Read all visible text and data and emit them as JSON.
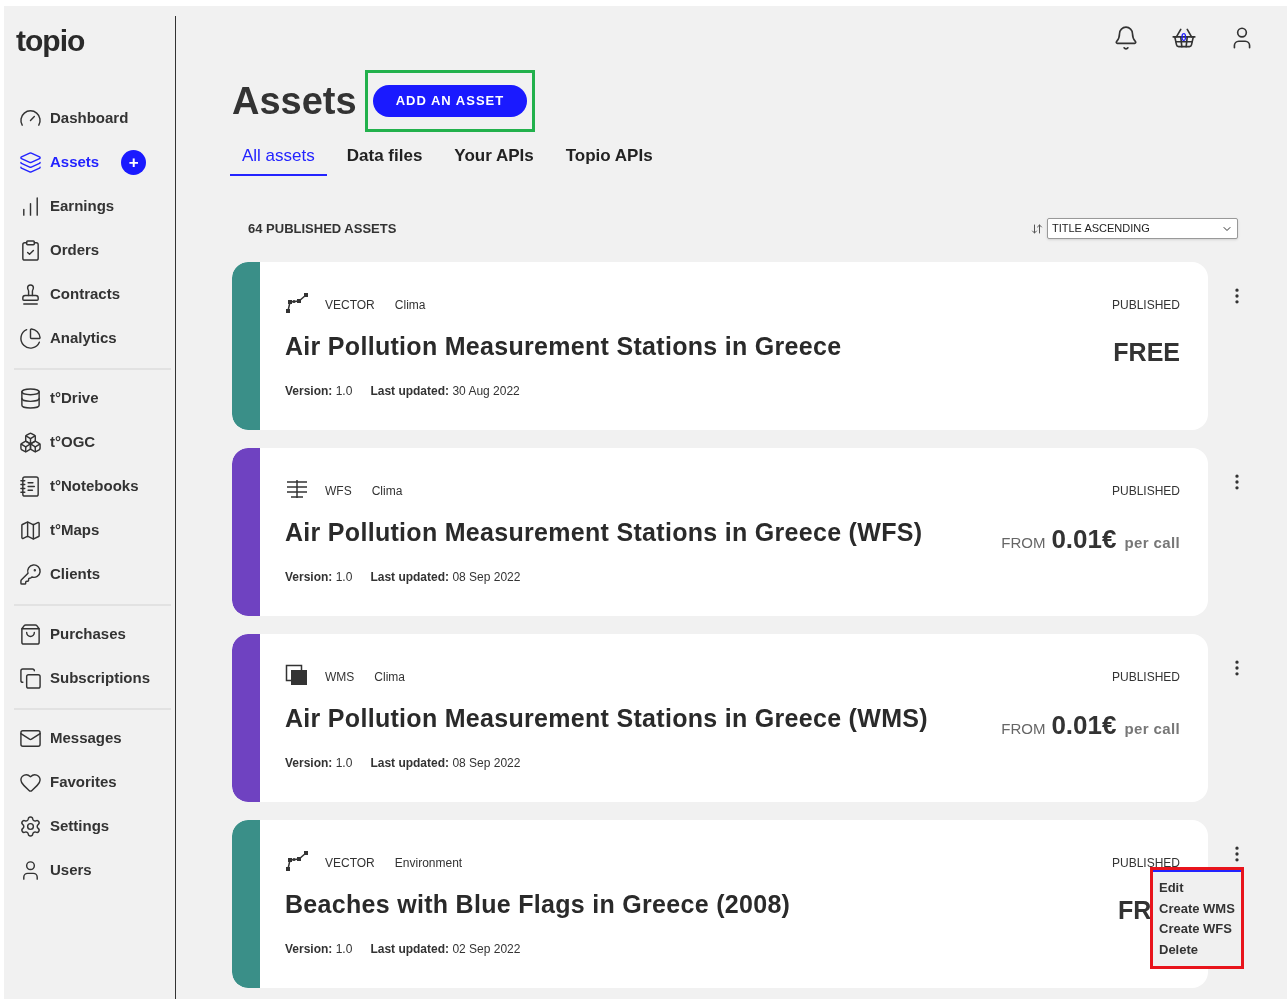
{
  "logo": "topio",
  "header": {
    "cart_count": "0"
  },
  "sidebar": {
    "groups": [
      {
        "items": [
          {
            "label": "Dashboard",
            "selected": false
          },
          {
            "label": "Assets",
            "selected": true,
            "badge": "+"
          },
          {
            "label": "Earnings",
            "selected": false
          },
          {
            "label": "Orders",
            "selected": false
          },
          {
            "label": "Contracts",
            "selected": false
          },
          {
            "label": "Analytics",
            "selected": false
          }
        ]
      },
      {
        "items": [
          {
            "label": "t°Drive",
            "selected": false
          },
          {
            "label": "t°OGC",
            "selected": false
          },
          {
            "label": "t°Notebooks",
            "selected": false
          },
          {
            "label": "t°Maps",
            "selected": false
          },
          {
            "label": "Clients",
            "selected": false
          }
        ]
      },
      {
        "items": [
          {
            "label": "Purchases",
            "selected": false
          },
          {
            "label": "Subscriptions",
            "selected": false
          }
        ]
      },
      {
        "items": [
          {
            "label": "Messages",
            "selected": false
          },
          {
            "label": "Favorites",
            "selected": false
          },
          {
            "label": "Settings",
            "selected": false
          },
          {
            "label": "Users",
            "selected": false
          }
        ]
      }
    ]
  },
  "page": {
    "title": "Assets",
    "add_button": "ADD AN ASSET"
  },
  "tabs": [
    {
      "label": "All assets",
      "selected": true
    },
    {
      "label": "Data files",
      "selected": false
    },
    {
      "label": "Your APIs",
      "selected": false
    },
    {
      "label": "Topio APIs",
      "selected": false
    }
  ],
  "count": "64 PUBLISHED ASSETS",
  "sort": {
    "value": "TITLE ASCENDING"
  },
  "assets": [
    {
      "kind": "vector",
      "color": "#3a8f88",
      "type": "VECTOR",
      "topic": "Clima",
      "status": "PUBLISHED",
      "title": "Air Pollution Measurement Stations in Greece",
      "version": "**Version:** 1.0",
      "updated": "**Last updated:** 30 Aug 2022",
      "price": {
        "kind": "free",
        "text": "FREE"
      }
    },
    {
      "kind": "wfs",
      "color": "#6f42c1",
      "type": "WFS",
      "topic": "Clima",
      "status": "PUBLISHED",
      "title": "Air Pollution Measurement Stations in Greece (WFS)",
      "version": "**Version:** 1.0",
      "updated": "**Last updated:** 08 Sep 2022",
      "price": {
        "kind": "from",
        "prefix": "FROM",
        "amount": "0.01€",
        "unit": "per call"
      }
    },
    {
      "kind": "wms",
      "color": "#6f42c1",
      "type": "WMS",
      "topic": "Clima",
      "status": "PUBLISHED",
      "title": "Air Pollution Measurement Stations in Greece (WMS)",
      "version": "**Version:** 1.0",
      "updated": "**Last updated:** 08 Sep 2022",
      "price": {
        "kind": "from",
        "prefix": "FROM",
        "amount": "0.01€",
        "unit": "per call"
      }
    },
    {
      "kind": "vector",
      "color": "#3a8f88",
      "type": "VECTOR",
      "topic": "Environment",
      "status": "PUBLISHED",
      "title": "Beaches with Blue Flags in Greece (2008)",
      "version": "**Version:** 1.0",
      "updated": "**Last updated:** 02 Sep 2022",
      "price": {
        "kind": "free",
        "text": "FR"
      },
      "menu": [
        "Edit",
        "Create WMS",
        "Create WFS",
        "Delete"
      ]
    }
  ]
}
